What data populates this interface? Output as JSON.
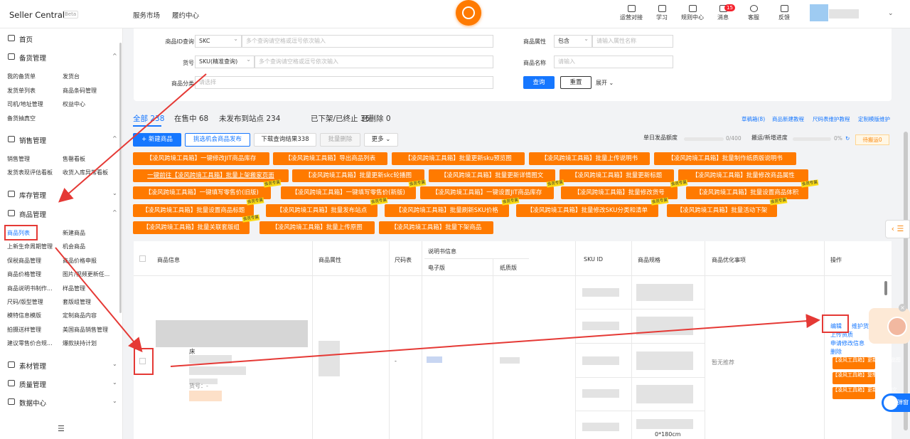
{
  "header": {
    "logo": "Seller Central",
    "beta": "Beta",
    "nav": [
      "服务市场",
      "履约中心"
    ],
    "icons": [
      {
        "label": "运营对接",
        "icon": "chat-icon"
      },
      {
        "label": "学习",
        "icon": "book-icon"
      },
      {
        "label": "规则中心",
        "icon": "doc-icon"
      },
      {
        "label": "消息",
        "icon": "bell-icon",
        "badge": "15"
      },
      {
        "label": "客服",
        "icon": "headset-icon"
      },
      {
        "label": "反馈",
        "icon": "feedback-icon"
      }
    ]
  },
  "sidebar": {
    "home": "首页",
    "sections": [
      {
        "title": "备货管理",
        "items": [
          "我的备货单",
          "发货台",
          "发货单列表",
          "商品条码管理",
          "司机/地址管理",
          "权益中心",
          "备货抽真空"
        ]
      },
      {
        "title": "销售管理",
        "items": [
          "销售管理",
          "售罄看板",
          "发货表现评估看板",
          "收货入库异常看板"
        ]
      },
      {
        "title": "库存管理",
        "items": []
      },
      {
        "title": "商品管理",
        "items": [
          "商品列表",
          "新建商品",
          "上新生命周期管理",
          "机会商品",
          "保税商品管理",
          "商品价格申报",
          "商品价格管理",
          "图片/视频更新任...",
          "商品说明书制作...",
          "样品管理",
          "尺码/版型管理",
          "套版组管理",
          "模特信息模版",
          "定制商品内容",
          "拍摄送样管理",
          "美国商品销售管理",
          "建议零售价合规...",
          "爆款扶持计划"
        ]
      },
      {
        "title": "素材管理",
        "items": []
      },
      {
        "title": "质量管理",
        "items": []
      },
      {
        "title": "数据中心",
        "items": []
      }
    ]
  },
  "filters": {
    "id_label": "商品ID查询",
    "id_type": "SKC",
    "id_placeholder": "多个查询请空格或逗号依次输入",
    "code_label": "货号",
    "code_type": "SKU(精准查询)",
    "code_placeholder": "多个查询请空格或逗号依次输入",
    "cat_label": "商品分类",
    "cat_placeholder": "请选择",
    "attr_label": "商品属性",
    "attr_type": "包含",
    "attr_placeholder": "请输入属性名称",
    "name_label": "商品名称",
    "name_placeholder": "请输入",
    "query": "查询",
    "reset": "重置",
    "expand": "展开 ⌄"
  },
  "tabs": [
    "全部 238",
    "在售中 68",
    "未发布到站点 234",
    "已下架/已终止 36",
    "已删除 0"
  ],
  "links": [
    "草稿箱(8)",
    "商品新建教程",
    "尺码表维护教程",
    "定制模版维护"
  ],
  "actions": [
    "+ 新建商品",
    "挑选机会商品发布",
    "下载查询结果338",
    "批量删除",
    "更多 ⌄"
  ],
  "progress": {
    "daily_label": "单日发品额度",
    "daily_value": "0/400",
    "move_label": "搬运/新增进度",
    "move_value": "0%",
    "refresh": "↻",
    "pending": "待搬运0"
  },
  "vip": "会员专属",
  "tool_tags": [
    [
      "【凌风跨境工具箱】一键修改JIT商品库存",
      "【凌风跨境工具箱】导出商品列表",
      "【凌风跨境工具箱】批量更新sku预览图",
      "【凌风跨境工具箱】批量上传说明书",
      "【凌风跨境工具箱】批量制作纸质版说明书"
    ],
    [
      "一键前往【凌风跨境工具箱】批量上架搬家页面",
      "【凌风跨境工具箱】批量更新skc轮播图",
      "【凌风跨境工具箱】批量更新详情图文",
      "【凌风跨境工具箱】批量更新标题",
      "【凌风跨境工具箱】批量修改商品属性"
    ],
    [
      "【凌风跨境工具箱】一键填写零售价(旧版)",
      "【凌风跨境工具箱】一键填写零售价(新版)",
      "【凌风跨境工具箱】一键设置JIT商品库存",
      "【凌风跨境工具箱】批量修改货号",
      "【凌风跨境工具箱】批量设置商品体积"
    ],
    [
      "【凌风跨境工具箱】批量设置商品标题",
      "【凌风跨境工具箱】批量发布站点",
      "【凌风跨境工具箱】批量刷新SKU价格",
      "【凌风跨境工具箱】批量修改SKU分类和清单",
      "【凌风跨境工具箱】批量活动下架"
    ],
    [
      "【凌风跨境工具箱】批量关联套版组",
      "【凌风跨境工具箱】批量上传原图",
      "【凌风跨境工具箱】批量下架商品"
    ]
  ],
  "table": {
    "headers": [
      "商品信息",
      "商品属性",
      "尺码表",
      "说明书信息",
      "电子版",
      "纸质版",
      "SKU ID",
      "商品规格",
      "商品优化事项",
      "操作"
    ],
    "row": {
      "title_frag": "床",
      "code_label": "货号：-",
      "size_chart": "-",
      "optimize": "暂无推荐",
      "spec_extra": "0*180cm"
    },
    "ops": [
      "编辑",
      "维护货号",
      "上传资质",
      "申请修改信息",
      "删除"
    ],
    "op_tools": [
      "【凌风工具箱】更新sku预览图",
      "【凌风工具箱】复制产品",
      "【凌风工具箱】更新详情图文"
    ]
  },
  "floating": {
    "toggle": "弹窗",
    "sidetab": "‹ ☰"
  }
}
